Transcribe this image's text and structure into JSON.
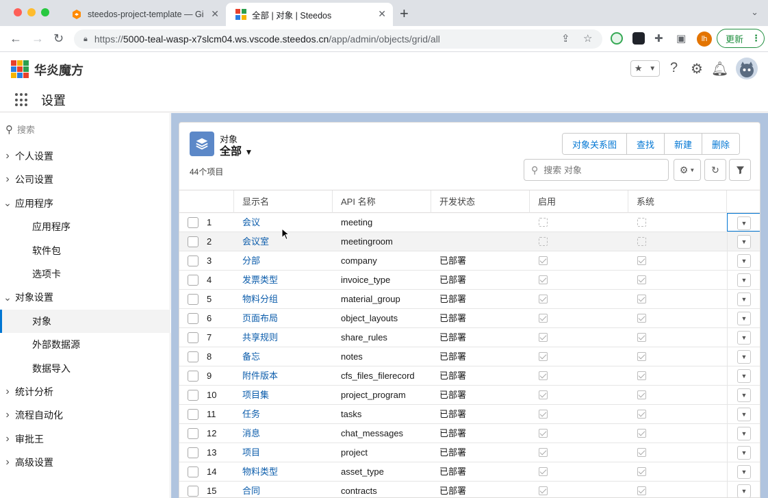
{
  "browser": {
    "tabs": [
      {
        "title": "steedos-project-template — Gi",
        "active": false
      },
      {
        "title": "全部 | 对象 | Steedos",
        "active": true
      }
    ],
    "url_prefix": "https://",
    "url_host": "5000-teal-wasp-x7slcm04.ws.vscode.steedos.cn",
    "url_path": "/app/admin/objects/grid/all",
    "profile_initials": "lh",
    "update_label": "更新"
  },
  "header": {
    "brand": "华炎魔方",
    "app_name": "设置"
  },
  "sidebar": {
    "search_placeholder": "搜索",
    "items": [
      {
        "label": "个人设置",
        "level": 0,
        "expanded": false
      },
      {
        "label": "公司设置",
        "level": 0,
        "expanded": false
      },
      {
        "label": "应用程序",
        "level": 0,
        "expanded": true
      },
      {
        "label": "应用程序",
        "level": 1
      },
      {
        "label": "软件包",
        "level": 1
      },
      {
        "label": "选项卡",
        "level": 1
      },
      {
        "label": "对象设置",
        "level": 0,
        "expanded": true
      },
      {
        "label": "对象",
        "level": 1,
        "active": true
      },
      {
        "label": "外部数据源",
        "level": 1
      },
      {
        "label": "数据导入",
        "level": 1
      },
      {
        "label": "统计分析",
        "level": 0,
        "expanded": false
      },
      {
        "label": "流程自动化",
        "level": 0,
        "expanded": false
      },
      {
        "label": "审批王",
        "level": 0,
        "expanded": false
      },
      {
        "label": "高级设置",
        "level": 0,
        "expanded": false
      }
    ]
  },
  "list": {
    "object_label": "对象",
    "view_name": "全部",
    "count_text": "44个项目",
    "buttons": [
      "对象关系图",
      "查找",
      "新建",
      "删除"
    ],
    "search_placeholder": "搜索 对象",
    "columns": [
      "显示名",
      "API 名称",
      "开发状态",
      "启用",
      "系统"
    ],
    "rows": [
      {
        "num": "1",
        "name": "会议",
        "api": "meeting",
        "state": "",
        "enabled": null,
        "system": null
      },
      {
        "num": "2",
        "name": "会议室",
        "api": "meetingroom",
        "state": "",
        "enabled": null,
        "system": null
      },
      {
        "num": "3",
        "name": "分部",
        "api": "company",
        "state": "已部署",
        "enabled": true,
        "system": true
      },
      {
        "num": "4",
        "name": "发票类型",
        "api": "invoice_type",
        "state": "已部署",
        "enabled": true,
        "system": true
      },
      {
        "num": "5",
        "name": "物料分组",
        "api": "material_group",
        "state": "已部署",
        "enabled": true,
        "system": true
      },
      {
        "num": "6",
        "name": "页面布局",
        "api": "object_layouts",
        "state": "已部署",
        "enabled": true,
        "system": true
      },
      {
        "num": "7",
        "name": "共享规则",
        "api": "share_rules",
        "state": "已部署",
        "enabled": true,
        "system": true
      },
      {
        "num": "8",
        "name": "备忘",
        "api": "notes",
        "state": "已部署",
        "enabled": true,
        "system": true
      },
      {
        "num": "9",
        "name": "附件版本",
        "api": "cfs_files_filerecord",
        "state": "已部署",
        "enabled": true,
        "system": true
      },
      {
        "num": "10",
        "name": "项目集",
        "api": "project_program",
        "state": "已部署",
        "enabled": true,
        "system": true
      },
      {
        "num": "11",
        "name": "任务",
        "api": "tasks",
        "state": "已部署",
        "enabled": true,
        "system": true
      },
      {
        "num": "12",
        "name": "消息",
        "api": "chat_messages",
        "state": "已部署",
        "enabled": true,
        "system": true
      },
      {
        "num": "13",
        "name": "项目",
        "api": "project",
        "state": "已部署",
        "enabled": true,
        "system": true
      },
      {
        "num": "14",
        "name": "物料类型",
        "api": "asset_type",
        "state": "已部署",
        "enabled": true,
        "system": true
      },
      {
        "num": "15",
        "name": "合同",
        "api": "contracts",
        "state": "已部署",
        "enabled": true,
        "system": true
      }
    ]
  },
  "colors": {
    "accent": "#0176d3",
    "link": "#0b5cab",
    "page_bg": "#b0c4df",
    "object_icon": "#5c88c8"
  }
}
